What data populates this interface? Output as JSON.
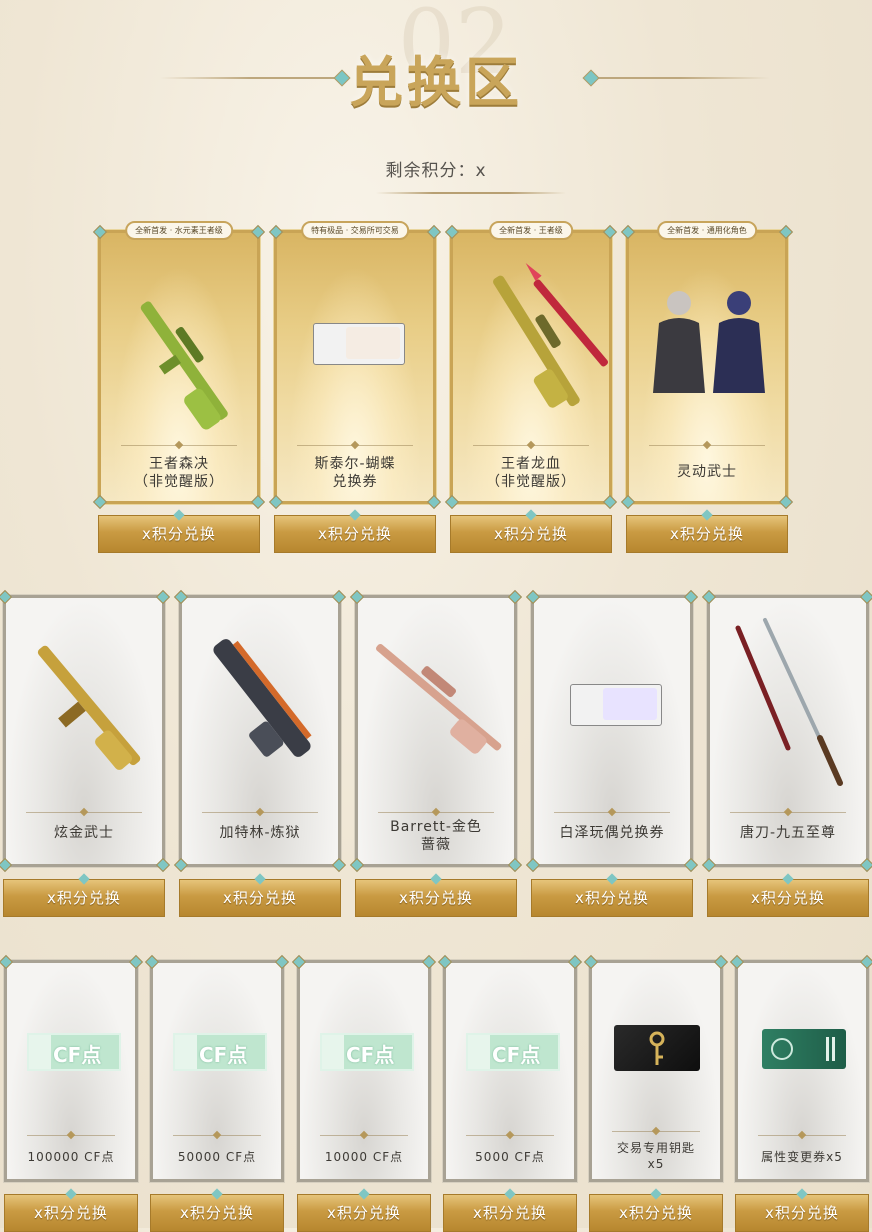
{
  "header": {
    "deco_number": "02",
    "title": "兑换区",
    "points_text": "剩余积分：x"
  },
  "colors": {
    "gold": "#c9a455",
    "teal_accent": "#7fc6c3",
    "button_gold": "#c99a42"
  },
  "row1": [
    {
      "tag": "全新首发 · 水元素王者级",
      "name_line1": "王者森决",
      "name_line2": "（非觉醒版）",
      "button": "x积分兑换",
      "art_icon": "green-sniper-rifle-icon"
    },
    {
      "tag": "特有极品 · 交易所可交易",
      "name_line1": "斯泰尔-蝴蝶",
      "name_line2": "兑换券",
      "button": "x积分兑换",
      "art_icon": "exchange-ticket-icon"
    },
    {
      "tag": "全新首发 · 王者级",
      "name_line1": "王者龙血",
      "name_line2": "（非觉醒版）",
      "button": "x积分兑换",
      "art_icon": "dragon-blood-rifle-icon"
    },
    {
      "tag": "全新首发 · 通用化角色",
      "name_line1": "灵动武士",
      "name_line2": "",
      "button": "x积分兑换",
      "art_icon": "character-duo-icon"
    }
  ],
  "row2": [
    {
      "name_line1": "炫金武士",
      "name_line2": "",
      "button": "x积分兑换",
      "art_icon": "gold-rifle-icon"
    },
    {
      "name_line1": "加特林-炼狱",
      "name_line2": "",
      "button": "x积分兑换",
      "art_icon": "gatling-gun-icon"
    },
    {
      "name_line1": "Barrett-金色",
      "name_line2": "蔷薇",
      "button": "x积分兑换",
      "art_icon": "rose-sniper-icon"
    },
    {
      "name_line1": "白泽玩偶兑换券",
      "name_line2": "",
      "button": "x积分兑换",
      "art_icon": "doll-ticket-icon"
    },
    {
      "name_line1": "唐刀-九五至尊",
      "name_line2": "",
      "button": "x积分兑换",
      "art_icon": "tang-sword-icon"
    }
  ],
  "row3": [
    {
      "name_line1": "100000 CF点",
      "name_line2": "",
      "button": "x积分兑换",
      "ticket_text": "CF点"
    },
    {
      "name_line1": "50000 CF点",
      "name_line2": "",
      "button": "x积分兑换",
      "ticket_text": "CF点"
    },
    {
      "name_line1": "10000 CF点",
      "name_line2": "",
      "button": "x积分兑换",
      "ticket_text": "CF点"
    },
    {
      "name_line1": "5000 CF点",
      "name_line2": "",
      "button": "x积分兑换",
      "ticket_text": "CF点"
    },
    {
      "name_line1": "交易专用钥匙",
      "name_line2": "x5",
      "button": "x积分兑换",
      "art_icon": "key-icon"
    },
    {
      "name_line1": "属性变更券x5",
      "name_line2": "",
      "button": "x积分兑换",
      "art_icon": "attribute-ticket-icon"
    }
  ]
}
